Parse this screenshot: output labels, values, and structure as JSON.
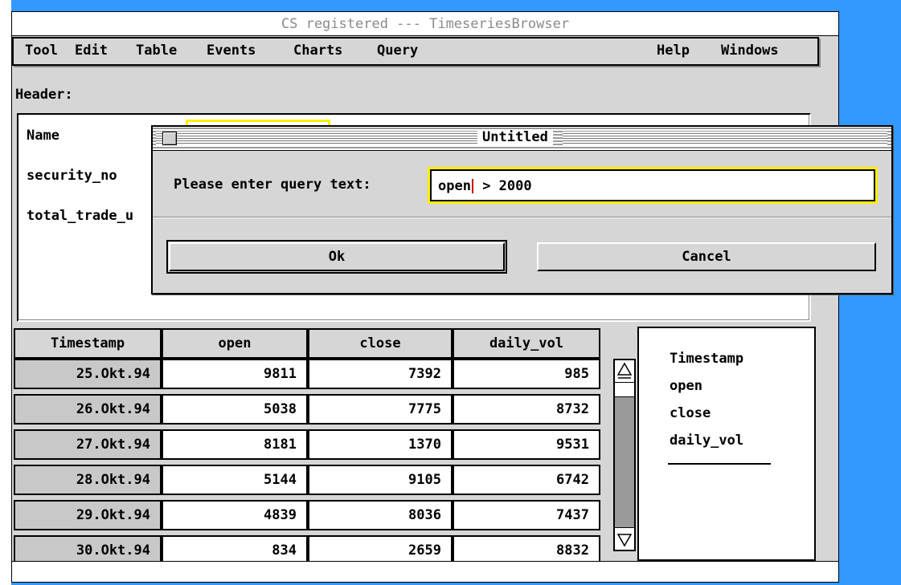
{
  "window": {
    "title": "CS registered --- TimeseriesBrowser"
  },
  "menu": {
    "left": [
      "Tool",
      "Edit",
      "Table",
      "Events",
      "Charts",
      "Query"
    ],
    "right": [
      "Help",
      "Windows"
    ]
  },
  "header": {
    "label": "Header:",
    "fields": [
      "Name",
      "security_no",
      "total_trade_u"
    ]
  },
  "dialog": {
    "title": "Untitled",
    "prompt": "Please enter query text:",
    "query_before_caret": "open",
    "query_after_caret": " > 2000",
    "ok_label": "Ok",
    "cancel_label": "Cancel"
  },
  "table": {
    "columns": [
      "Timestamp",
      "open",
      "close",
      "daily_vol"
    ],
    "rows": [
      [
        "25.Okt.94",
        "9811",
        "7392",
        "985"
      ],
      [
        "26.Okt.94",
        "5038",
        "7775",
        "8732"
      ],
      [
        "27.Okt.94",
        "8181",
        "1370",
        "9531"
      ],
      [
        "28.Okt.94",
        "5144",
        "9105",
        "6742"
      ],
      [
        "29.Okt.94",
        "4839",
        "8036",
        "7437"
      ],
      [
        "30.Okt.94",
        "834",
        "2659",
        "8832"
      ]
    ]
  },
  "column_list": {
    "items": [
      "Timestamp",
      "open",
      "close",
      "daily_vol"
    ]
  },
  "icons": {
    "dialog_close": "close-box-icon",
    "scroll_up": "arrow-up-icon",
    "scroll_down": "arrow-down-icon"
  }
}
